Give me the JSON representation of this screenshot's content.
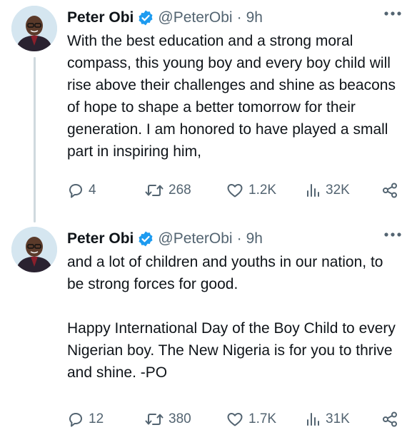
{
  "tweets": [
    {
      "name": "Peter Obi",
      "handle": "@PeterObi",
      "separator": "·",
      "time": "9h",
      "paragraphs": [
        "With the best education and a strong moral compass, this young boy and every boy child will rise above their challenges and shine as beacons of hope to shape a better tomorrow for their generation. I am honored to have played a small part in inspiring him,"
      ],
      "replies": "4",
      "retweets": "268",
      "likes": "1.2K",
      "views": "32K"
    },
    {
      "name": "Peter Obi",
      "handle": "@PeterObi",
      "separator": "·",
      "time": "9h",
      "paragraphs": [
        "and a lot of children and youths in our nation, to be strong forces for good.",
        "Happy International Day of the Boy Child to every Nigerian boy. The New Nigeria is for you to thrive and shine. -PO"
      ],
      "replies": "12",
      "retweets": "380",
      "likes": "1.7K",
      "views": "31K"
    }
  ],
  "icons": {
    "verified": "verified-badge-icon",
    "more": "more-options-icon",
    "reply": "reply-icon",
    "retweet": "retweet-icon",
    "like": "like-icon",
    "views": "views-icon",
    "share": "share-icon"
  },
  "colors": {
    "verified": "#1d9bf0",
    "text": "#0f1419",
    "secondary": "#536471",
    "thread_line": "#cfd9de"
  }
}
